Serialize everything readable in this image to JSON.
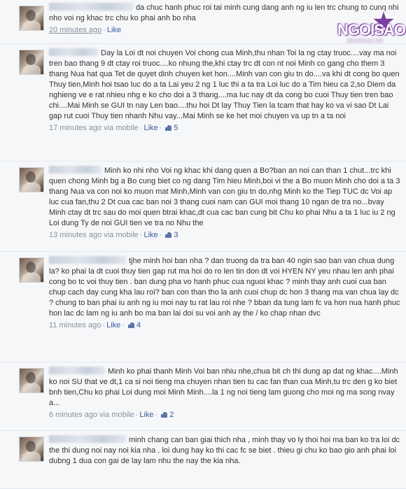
{
  "watermark": {
    "brand": "NGOISAO",
    "sub": "NGOISAO.VN",
    "star_color": "#7b3fa0"
  },
  "comments": [
    {
      "text": "da chuc hanh phuc roi tai minh cung dang anh ng iu len trc chung to cung nhi nho voi ng khac trc chu ko phai anh bo nha",
      "time": "20 minutes ago",
      "via": "",
      "like": "Like",
      "likes": ""
    },
    {
      "text": "Day la Loi dt noi chuyen Voi chong cua Minh,thu nhan Toi la ng ctay truoc....vay ma noi tren bao thang 9 dt ctay roi truoc....ko nhung the,khi ctay trc dt con nt noi Minh co gang cho them 3 thang Nua hat qua Tet de quyet dinh chuyen ket hon....Minh van con giu tn do....va khi dt cong bo quen Thuy tien,Minh hoi tsao luc do a ta Lai yeu 2 ng 1 luc thi a ta tra Loi luc do a Tim hieu ca 2,so Diem da nghieng ve e rat nhieu nhg e ko cho doi a 3 thang....ma luc nay dt da cong bo cuoi Thuy tien tren bao chi....Mai Minh se GUI tn nay Len bao....thu hoi Dt lay Thuy Tien la tcam that hay ko va vi sao Dt Lai gap rut cuoi Thuy tien nhanh Nhu vay...Mai Minh se ke het moi chuyen va up tn a ta noi",
      "time": "17 minutes ago",
      "via": "via mobile",
      "like": "Like",
      "likes": "5"
    },
    {
      "text": "Minh ko nhi nho Voi ng khac khi dang quen a Bo?ban an noi can than 1 chut...trc khi quen chong Minh bg a Bo cung biet co ng dang Tim hieu Minh,boi vi the a Bo muon Minh cho doi a ta 3 thang Nua va con noi ko muon mat Minh,Minh van con giu tn do,nhg Minh ko the Tiep TUC dc Voi ap luc cua fan,thu 2 Dt cua cac ban noi 3 thang cuoi nam can GUI moi thang 10 ngan de tra no...bvay Minh ctay dt trc sau do moi quen btrai khac,dt cua cac ban cung bit Chu ko phai Nhu a ta 1 luc iu 2 ng Loi dung Ty de noi GUI tien ve tra no Nhu the",
      "time": "13 minutes ago",
      "via": "via mobile",
      "like": "Like",
      "likes": "3"
    },
    {
      "text": "tjhe minh hoi ban nha ? dan truong da tra ban 40 ngin sao ban van chua dung la? ko phai la dt cuoi thuy tien gap rut ma hoi do ro len tin don dt voi HYEN NY yeu nhau len anh phai cong bo tc voi thuy tien . ban dung pha vo hanh phuc cua nguoi khac ? minh thay anh cuoi cua ban chup cach day cung kha lau roi? ban con than tho la anh cuoi chup dc hon 3 thang ma van chua lay dc ? chung to ban phai iu anh ng iu moi nay tu rat lau roi nhe ? bban da tung lam fc va hon nua hanh phuc hon lac dc lam ng iu anh bo ma ban lai doi su voi anh ay the / ko chap nhan dvc",
      "time": "11 minutes ago",
      "via": "",
      "like": "Like",
      "likes": "4"
    },
    {
      "text": "Minh ko phai thanh Minh Voi ban nhiu nhe,chua bit ch thi dung ap dat ng khac....Minh ko noi SU that ve dt,1 ca si noi tieng ma chuyen nhan tien tu cac fan than cua Minh,tu trc den g ko biet bnh tien,Chu ko phai Loi dung moi Minh Minh....la 1 ng noi tieng lam guong cho moi ng ma song nvay a...",
      "time": "6 minutes ago",
      "via": "via mobile",
      "like": "Like",
      "likes": "2"
    },
    {
      "text": "minh chang can ban giai thich nha , minh thay vo ly thoi hoi ma ban ko tra loi dc the thi dung noi nay noi kia nha . loi dung hay ko thi cac fc se biet . thieu gi chu ko bao gio anh phai loi dubng 1 dua con gai de lay lam nhu the nay the kia nha.",
      "time": "",
      "via": "",
      "like": "",
      "likes": ""
    }
  ]
}
